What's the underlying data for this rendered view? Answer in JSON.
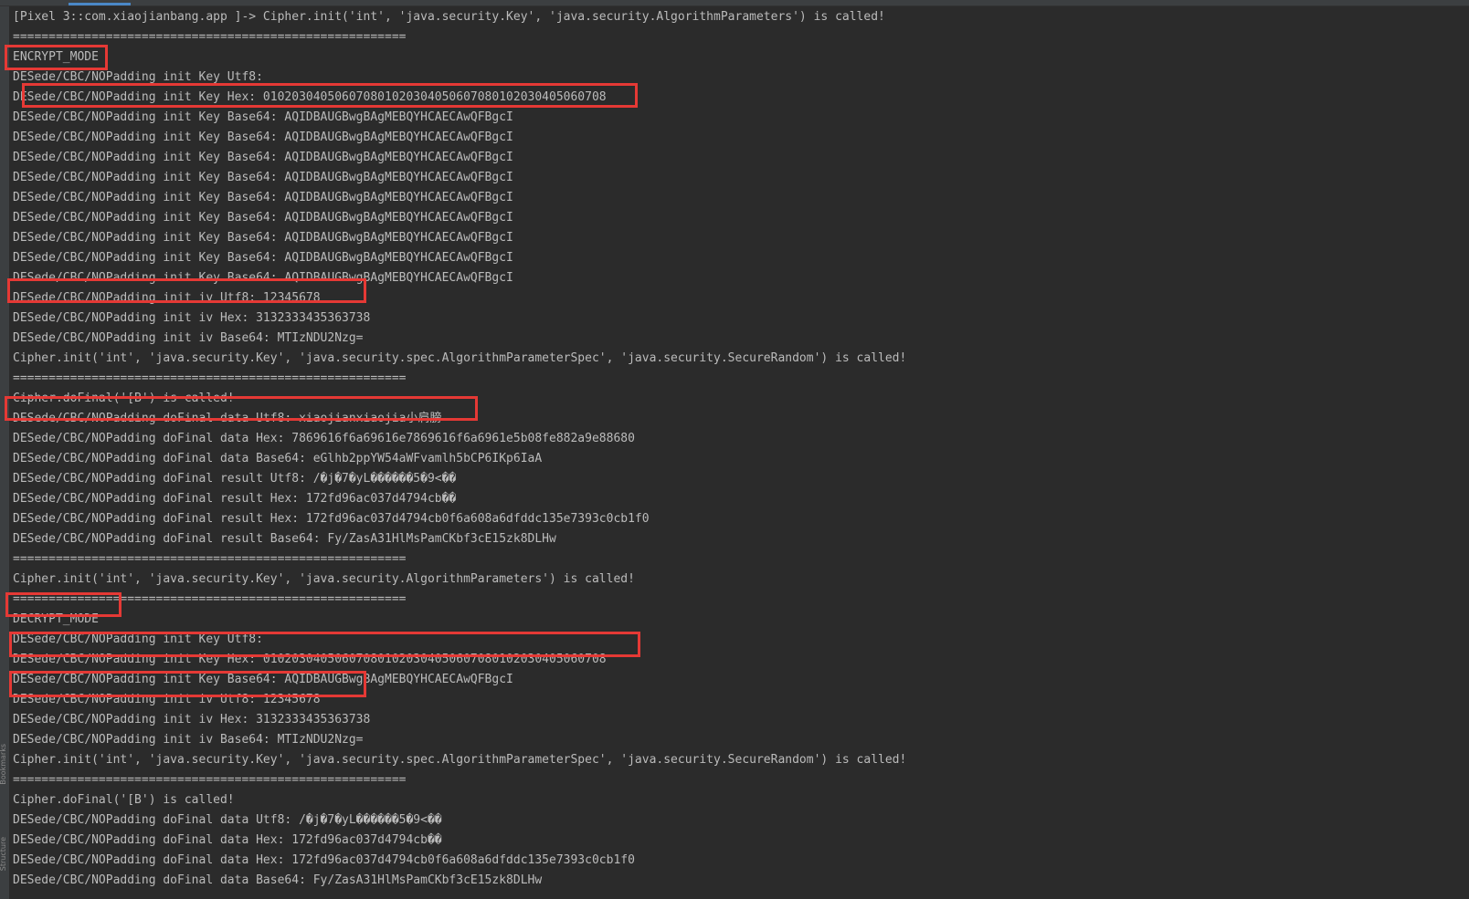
{
  "sidebar": {
    "bookmarks_label": "Bookmarks",
    "structure_label": "Structure"
  },
  "console": {
    "lines": [
      "[Pixel 3::com.xiaojianbang.app ]-> Cipher.init('int', 'java.security.Key', 'java.security.AlgorithmParameters') is called!",
      "=======================================================",
      "ENCRYPT_MODE",
      "DESede/CBC/NOPadding init Key Utf8:",
      "DESede/CBC/NOPadding init Key Hex: 010203040506070801020304050607080102030405060708",
      "DESede/CBC/NOPadding init Key Base64: AQIDBAUGBwgBAgMEBQYHCAECAwQFBgcI",
      "DESede/CBC/NOPadding init Key Base64: AQIDBAUGBwgBAgMEBQYHCAECAwQFBgcI",
      "DESede/CBC/NOPadding init Key Base64: AQIDBAUGBwgBAgMEBQYHCAECAwQFBgcI",
      "DESede/CBC/NOPadding init Key Base64: AQIDBAUGBwgBAgMEBQYHCAECAwQFBgcI",
      "DESede/CBC/NOPadding init Key Base64: AQIDBAUGBwgBAgMEBQYHCAECAwQFBgcI",
      "DESede/CBC/NOPadding init Key Base64: AQIDBAUGBwgBAgMEBQYHCAECAwQFBgcI",
      "DESede/CBC/NOPadding init Key Base64: AQIDBAUGBwgBAgMEBQYHCAECAwQFBgcI",
      "DESede/CBC/NOPadding init Key Base64: AQIDBAUGBwgBAgMEBQYHCAECAwQFBgcI",
      "DESede/CBC/NOPadding init Key Base64: AQIDBAUGBwgBAgMEBQYHCAECAwQFBgcI",
      "DESede/CBC/NOPadding init iv Utf8: 12345678",
      "DESede/CBC/NOPadding init iv Hex: 3132333435363738",
      "DESede/CBC/NOPadding init iv Base64: MTIzNDU2Nzg=",
      "Cipher.init('int', 'java.security.Key', 'java.security.spec.AlgorithmParameterSpec', 'java.security.SecureRandom') is called!",
      "=======================================================",
      "Cipher.doFinal('[B') is called!",
      "DESede/CBC/NOPadding doFinal data Utf8: xiaojianxiaojia小肩膀",
      "DESede/CBC/NOPadding doFinal data Hex: 7869616f6a69616e7869616f6a6961e5b08fe882a9e88680",
      "DESede/CBC/NOPadding doFinal data Base64: eGlhb2ppYW54aWFvamlh5bCP6IKp6IaA",
      "DESede/CBC/NOPadding doFinal result Utf8: /�j�7�yL������5�9<��",
      "DESede/CBC/NOPadding doFinal result Hex: 172fd96ac037d4794cb��",
      "DESede/CBC/NOPadding doFinal result Hex: 172fd96ac037d4794cb0f6a608a6dfddc135e7393c0cb1f0",
      "DESede/CBC/NOPadding doFinal result Base64: Fy/ZasA31HlMsPamCKbf3cE15zk8DLHw",
      "=======================================================",
      "Cipher.init('int', 'java.security.Key', 'java.security.AlgorithmParameters') is called!",
      "=======================================================",
      "DECRYPT_MODE",
      "DESede/CBC/NOPadding init Key Utf8:",
      "DESede/CBC/NOPadding init Key Hex: 010203040506070801020304050607080102030405060708",
      "DESede/CBC/NOPadding init Key Base64: AQIDBAUGBwgBAgMEBQYHCAECAwQFBgcI",
      "DESede/CBC/NOPadding init iv Utf8: 12345678",
      "DESede/CBC/NOPadding init iv Hex: 3132333435363738",
      "DESede/CBC/NOPadding init iv Base64: MTIzNDU2Nzg=",
      "Cipher.init('int', 'java.security.Key', 'java.security.spec.AlgorithmParameterSpec', 'java.security.SecureRandom') is called!",
      "=======================================================",
      "Cipher.doFinal('[B') is called!",
      "DESede/CBC/NOPadding doFinal data Utf8: /�j�7�yL������5�9<��",
      "DESede/CBC/NOPadding doFinal data Hex: 172fd96ac037d4794cb��",
      "DESede/CBC/NOPadding doFinal data Hex: 172fd96ac037d4794cb0f6a608a6dfddc135e7393c0cb1f0",
      "DESede/CBC/NOPadding doFinal data Base64: Fy/ZasA31HlMsPamCKbf3cE15zk8DLHw"
    ]
  },
  "colors": {
    "background": "#2b2b2b",
    "text": "#bbbbbb",
    "highlight_box": "#e53935",
    "gutter": "#3c3f41",
    "active_tab_indicator": "#4a88c7"
  }
}
